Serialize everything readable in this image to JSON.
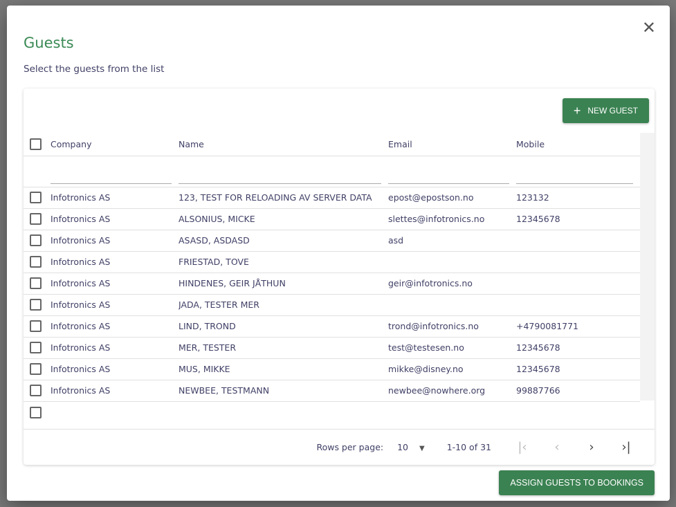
{
  "dialog": {
    "title": "Guests",
    "subtitle": "Select the guests from the list",
    "close_icon": "close-icon"
  },
  "toolbar": {
    "new_guest_label": "NEW GUEST"
  },
  "table": {
    "headers": [
      "Company",
      "Name",
      "Email",
      "Mobile"
    ],
    "rows": [
      [
        "Infotronics AS",
        "123, TEST FOR RELOADING AV SERVER DATA",
        "epost@epostson.no",
        "123132"
      ],
      [
        "Infotronics AS",
        "ALSONIUS, MICKE",
        "slettes@infotronics.no",
        "12345678"
      ],
      [
        "Infotronics AS",
        "ASASD, ASDASD",
        "asd",
        ""
      ],
      [
        "Infotronics AS",
        "FRIESTAD, TOVE",
        "",
        ""
      ],
      [
        "Infotronics AS",
        "HINDENES, GEIR JÅTHUN",
        "geir@infotronics.no",
        ""
      ],
      [
        "Infotronics AS",
        "JADA, TESTER MER",
        "",
        ""
      ],
      [
        "Infotronics AS",
        "LIND, TROND",
        "trond@infotronics.no",
        "+4790081771"
      ],
      [
        "Infotronics AS",
        "MER, TESTER",
        "test@testesen.no",
        "12345678"
      ],
      [
        "Infotronics AS",
        "MUS, MIKKE",
        "mikke@disney.no",
        "12345678"
      ],
      [
        "Infotronics AS",
        "NEWBEE, TESTMANN",
        "newbee@nowhere.org",
        "99887766"
      ]
    ]
  },
  "pagination": {
    "rows_per_page_label": "Rows per page:",
    "rows_per_page": "10",
    "range": "1-10 of 31"
  },
  "actions": {
    "assign_label": "ASSIGN GUESTS TO BOOKINGS"
  }
}
